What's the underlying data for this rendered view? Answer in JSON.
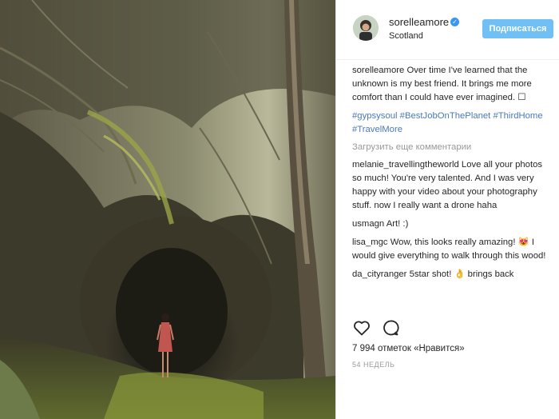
{
  "post": {
    "username": "sorelleamore",
    "location": "Scotland",
    "follow_label": "Подписаться",
    "caption_text": "Over time I've learned that the unknown is my best friend. It brings me more comfort than I could have ever imagined. ☐",
    "hashtags": "#gypsysoul #BestJobOnThePlanet #ThirdHome #TravelMore",
    "load_more": "Загрузить еще комментарии",
    "likes": "7 994 отметок «Нравится»",
    "time": "54 НЕДЕЛЬ"
  },
  "comments": [
    {
      "user": "melanie_travellingtheworld",
      "text": "Love all your photos so much! You're very talented. And I was very happy with your video about your photography stuff. now I really want a drone haha"
    },
    {
      "user": "usmagn",
      "text": "Art! :)"
    },
    {
      "user": "lisa_mgc",
      "text": "Wow, this looks really amazing! 😻 I would give everything to walk through this wood!"
    },
    {
      "user": "da_cityranger",
      "text": "5star shot! 👌 brings back"
    }
  ],
  "icons": {
    "like": "heart-outline-icon",
    "comment": "speech-bubble-icon",
    "verified": "verified-badge-icon"
  },
  "colors": {
    "follow_button": "#70c0f5",
    "hashtag": "#4a7ab8",
    "verified": "#3897f0"
  }
}
